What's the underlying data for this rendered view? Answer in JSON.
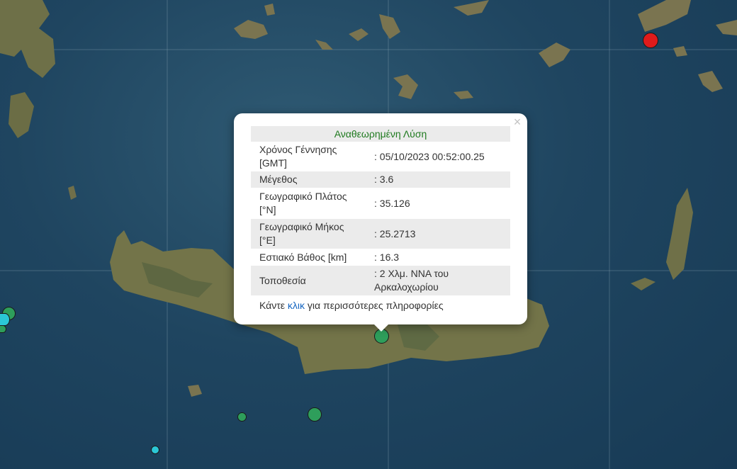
{
  "popup": {
    "title": "Αναθεωρημένη Λύση",
    "close_symbol": "×",
    "rows": [
      {
        "label": "Χρόνος Γέννησης [GMT]",
        "value": ": 05/10/2023 00:52:00.25"
      },
      {
        "label": "Μέγεθος",
        "value": ": 3.6"
      },
      {
        "label": "Γεωγραφικό Πλάτος [°N]",
        "value": ": 35.126"
      },
      {
        "label": "Γεωγραφικό Μήκος [°E]",
        "value": ": 25.2713"
      },
      {
        "label": "Εστιακό Βάθος [km]",
        "value": ": 16.3"
      },
      {
        "label": "Τοποθεσία",
        "value": ": 2 Χλμ. ΝΝΑ του Αρκαλοχωρίου"
      }
    ],
    "more_prefix": "Κάντε ",
    "more_link": "κλικ",
    "more_suffix": " για περισσότερες πληροφορίες"
  },
  "markers": [
    {
      "id": "selected",
      "color": "#2e9e5b"
    },
    {
      "id": "red",
      "color": "#e01b1b"
    },
    {
      "id": "green-west",
      "color": "#2e9e5b"
    },
    {
      "id": "cyan-west",
      "color": "#2bc7d6"
    },
    {
      "id": "green-west-small",
      "color": "#2e9e5b"
    },
    {
      "id": "green-south-large",
      "color": "#2e9e5b"
    },
    {
      "id": "green-south-small",
      "color": "#2e9e5b"
    },
    {
      "id": "cyan-south",
      "color": "#2bc7d6"
    }
  ]
}
